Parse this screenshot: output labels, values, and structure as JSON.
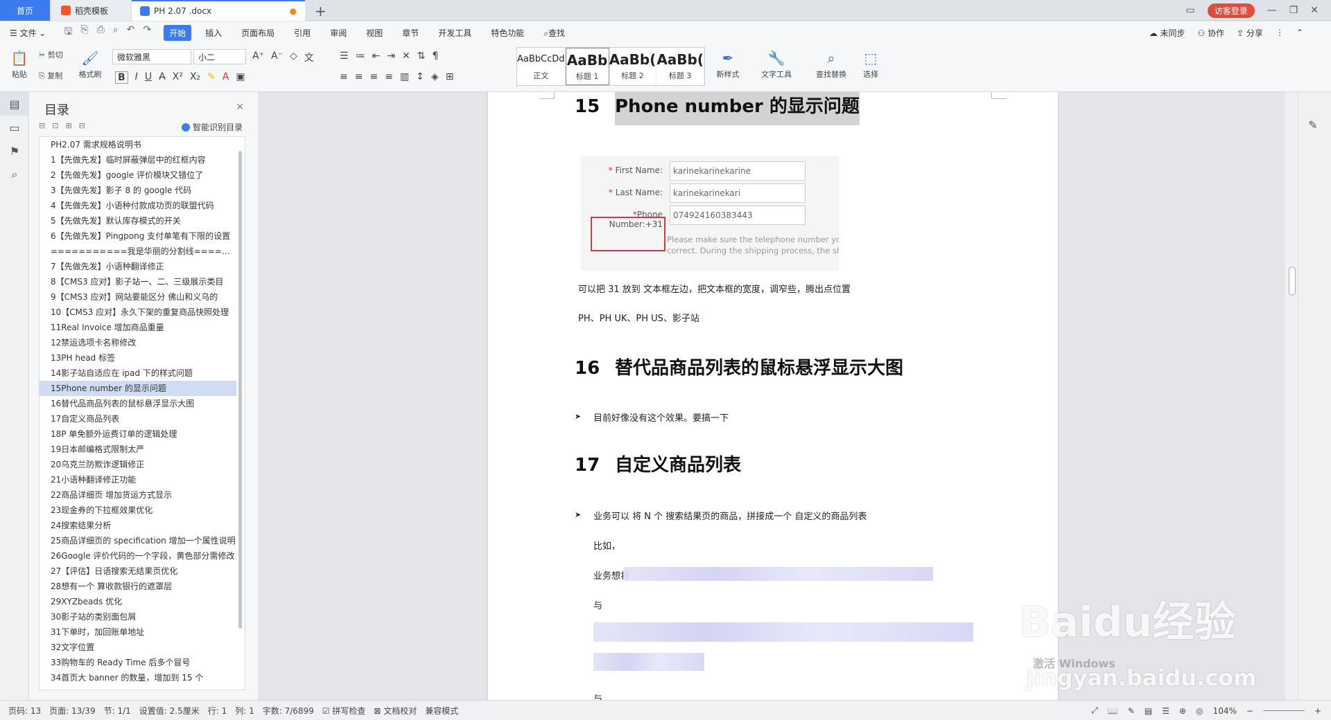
{
  "tabs": {
    "home": "首页",
    "template": "稻壳模板",
    "doc": "PH 2.07 .docx",
    "login": "访客登录"
  },
  "menu": {
    "file": "文件",
    "items": [
      "开始",
      "插入",
      "页面布局",
      "引用",
      "审阅",
      "视图",
      "章节",
      "开发工具",
      "特色功能"
    ],
    "search": "查找",
    "unsync": "未同步",
    "collab": "协作",
    "share": "分享"
  },
  "ribbon": {
    "paste": "粘贴",
    "cut": "剪切",
    "copy": "复制",
    "format_painter": "格式刷",
    "font_name": "微软雅黑",
    "font_size": "小二",
    "styles": [
      {
        "preview": "AaBbCcDd",
        "label": "正文"
      },
      {
        "preview": "AaBb",
        "label": "标题 1"
      },
      {
        "preview": "AaBb(",
        "label": "标题 2"
      },
      {
        "preview": "AaBb(",
        "label": "标题 3"
      }
    ],
    "new_style": "新样式",
    "text_tools": "文字工具",
    "find_replace": "查找替换",
    "select": "选择"
  },
  "toc": {
    "title": "目录",
    "smart": "智能识别目录",
    "items": [
      "PH2.07 需求规格说明书",
      "1【先做先发】临时屏蔽弹层中的红框内容",
      "2【先做先发】google 评价模块又错位了",
      "3【先做先发】影子 8 的 google 代码",
      "4【先做先发】小语种付款成功页的联盟代码",
      "5【先做先发】默认库存模式的开关",
      "6【先做先发】Pingpong 支付单笔有下限的设置",
      "===========我是华丽的分割线===========",
      "7【先做先发】小语种翻译修正",
      "8【CMS3 应对】影子站一、二、三级展示类目",
      "9【CMS3 应对】网站要能区分 佛山和义乌的",
      "10【CMS3 应对】永久下架的重复商品快照处理",
      "11Real Invoice 增加商品重量",
      "12禁运选项卡名称修改",
      "13PH head 标签",
      "14影子站自适应在 ipad 下的样式问题",
      "15Phone number 的显示问题",
      "16替代品商品列表的鼠标悬浮显示大图",
      "17自定义商品列表",
      "18P 单免额外运费订单的逻辑处理",
      "19日本邮编格式限制太严",
      "20乌克兰防欺诈逻辑修正",
      "21小语种翻译修正功能",
      "22商品详细页 增加货运方式显示",
      "23现金券的下拉框效果优化",
      "24搜索结果分析",
      "25商品详细页的 specification 增加一个属性说明",
      "26Google 评价代码的一个字段，黄色部分需修改",
      "27【评估】日语搜索无结果页优化",
      "28想有一个 算收款银行的遮罩层",
      "29XYZbeads 优化",
      "30影子站的类别面包屑",
      "31下单时，加回账单地址",
      "32文字位置",
      "33购物车的 Ready Time 后多个冒号",
      "34首页大 banner 的数量，增加到 15 个"
    ],
    "selected_index": 16
  },
  "doc": {
    "sec15": {
      "num": "15",
      "title": "Phone number 的显示问题"
    },
    "form": {
      "first_name_label": "First Name:",
      "first_name_value": "karinekarinekarine",
      "last_name_label": "Last Name:",
      "last_name_value": "karinekarinekari",
      "phone_label_1": "Phone",
      "phone_label_2": "Number:+31",
      "phone_value": "074924160383443",
      "hint1": "Please make sure the telephone number you",
      "hint2": "correct. During the shipping process, the ship"
    },
    "p1": "可以把 31 放到 文本框左边，把文本框的宽度，调窄些，腾出点位置",
    "p2": "PH、PH UK、PH US、影子站",
    "sec16": {
      "num": "16",
      "title": "替代品商品列表的鼠标悬浮显示大图"
    },
    "b16": "目前好像没有这个效果。要搞一下",
    "sec17": {
      "num": "17",
      "title": "自定义商品列表"
    },
    "b17": "业务可以 将 N 个 搜索结果页的商品，拼接成一个 自定义的商品列表",
    "p3": "比如，",
    "p4": "业务想将",
    "p5": "与",
    "p6": "与"
  },
  "status": {
    "page_code": "页码: 13",
    "page": "页面: 13/39",
    "section": "节: 1/1",
    "setting": "设置值: 2.5厘米",
    "row": "行: 1",
    "col": "列: 1",
    "words": "字数: 7/6899",
    "spell": "拼写检查",
    "proof": "文档校对",
    "compat": "兼容模式",
    "zoom": "104%"
  },
  "watermark": {
    "brand": "Baidu经验",
    "sub": "jingyan.baidu.com",
    "windows": "激活 Windows"
  }
}
